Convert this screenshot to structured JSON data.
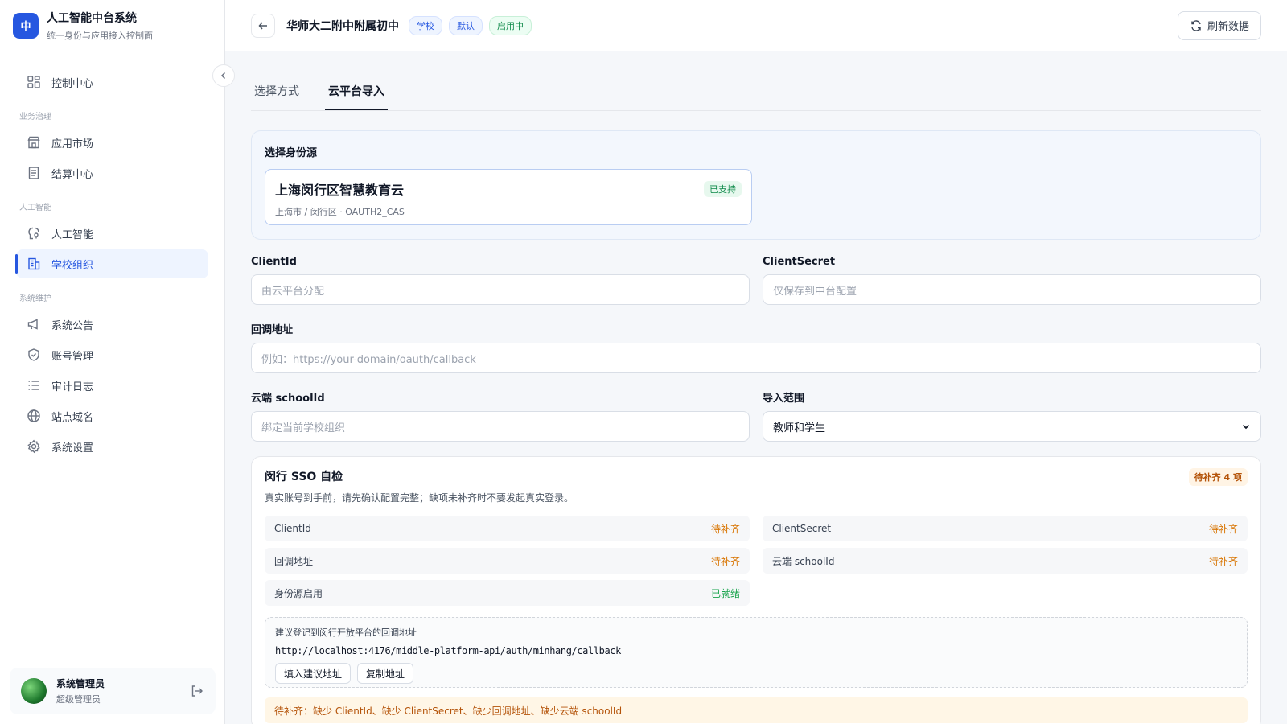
{
  "brand": {
    "logo_text": "中",
    "title": "人工智能中台系统",
    "subtitle": "统一身份与应用接入控制面"
  },
  "sidebar": {
    "items": [
      {
        "label": "控制中心",
        "icon": "dashboard-icon"
      },
      {
        "section": "业务治理"
      },
      {
        "label": "应用市场",
        "icon": "store-icon"
      },
      {
        "label": "结算中心",
        "icon": "receipt-icon"
      },
      {
        "section": "人工智能"
      },
      {
        "label": "人工智能",
        "icon": "brain-icon"
      },
      {
        "label": "学校组织",
        "icon": "building-icon",
        "active": true
      },
      {
        "section": "系统维护"
      },
      {
        "label": "系统公告",
        "icon": "megaphone-icon"
      },
      {
        "label": "账号管理",
        "icon": "shield-icon"
      },
      {
        "label": "审计日志",
        "icon": "list-icon"
      },
      {
        "label": "站点域名",
        "icon": "globe-icon"
      },
      {
        "label": "系统设置",
        "icon": "gear-icon"
      }
    ],
    "user": {
      "name": "系统管理员",
      "role": "超级管理员"
    }
  },
  "header": {
    "title": "华师大二附中附属初中",
    "tags": [
      "学校",
      "默认",
      "启用中"
    ],
    "refresh_label": "刷新数据"
  },
  "tabs": [
    "选择方式",
    "云平台导入"
  ],
  "source": {
    "label": "选择身份源",
    "name": "上海闵行区智慧教育云",
    "meta": "上海市 / 闵行区 · OAUTH2_CAS",
    "badge": "已支持"
  },
  "form": {
    "client_id": {
      "label": "ClientId",
      "placeholder": "由云平台分配"
    },
    "client_secret": {
      "label": "ClientSecret",
      "placeholder": "仅保存到中台配置"
    },
    "callback": {
      "label": "回调地址",
      "placeholder": "例如：https://your-domain/oauth/callback"
    },
    "school_id": {
      "label": "云端 schoolId",
      "placeholder": "绑定当前学校组织"
    },
    "scope": {
      "label": "导入范围",
      "value": "教师和学生"
    }
  },
  "sso": {
    "title": "闵行 SSO 自检",
    "badge": "待补齐 4 项",
    "desc": "真实账号到手前，请先确认配置完整；缺项未补齐时不要发起真实登录。",
    "checks": [
      {
        "label": "ClientId",
        "status": "待补齐",
        "ok": false
      },
      {
        "label": "ClientSecret",
        "status": "待补齐",
        "ok": false
      },
      {
        "label": "回调地址",
        "status": "待补齐",
        "ok": false
      },
      {
        "label": "云端 schoolId",
        "status": "待补齐",
        "ok": false
      },
      {
        "label": "身份源启用",
        "status": "已就绪",
        "ok": true
      }
    ],
    "suggest_label": "建议登记到闵行开放平台的回调地址",
    "suggest_url": "http://localhost:4176/middle-platform-api/auth/minhang/callback",
    "fill_button": "填入建议地址",
    "copy_button": "复制地址",
    "warning": "待补齐：缺少 ClientId、缺少 ClientSecret、缺少回调地址、缺少云端 schoolId"
  },
  "colors": {
    "accent": "#2657e0",
    "success": "#16a34a",
    "warning": "#d97706"
  }
}
